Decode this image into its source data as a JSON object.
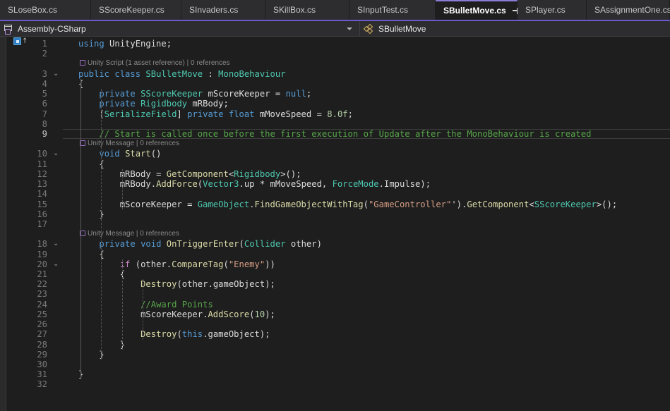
{
  "window": {
    "app": "Visual Studio",
    "theme": "dark"
  },
  "tabs": {
    "items": [
      {
        "label": "SLoseBox.cs",
        "active": false
      },
      {
        "label": "SScoreKeeper.cs",
        "active": false
      },
      {
        "label": "SInvaders.cs",
        "active": false
      },
      {
        "label": "SKillBox.cs",
        "active": false
      },
      {
        "label": "SInputTest.cs",
        "active": false
      },
      {
        "label": "SBulletMove.cs",
        "active": true
      },
      {
        "label": "SPlayer.cs",
        "active": false
      },
      {
        "label": "SAssignmentOne.cs",
        "active": false
      }
    ],
    "pin_icon": "pin-icon",
    "close_icon": "close-icon"
  },
  "navbar": {
    "project": "Assembly-CSharp",
    "project_icon": "project-icon",
    "member": "SBulletMove",
    "member_icon": "class-icon",
    "dropdown_icon": "chevron-down-icon"
  },
  "editor": {
    "filename": "SBulletMove.cs",
    "current_line": 9,
    "total_lines": 32,
    "glyph_icon": "unity-script-glyph-icon",
    "codelens": [
      {
        "line": 3,
        "text": "Unity Script (1 asset reference) | 0 references"
      },
      {
        "line": 10,
        "text": "Unity Message | 0 references"
      },
      {
        "line": 18,
        "text": "Unity Message | 0 references"
      }
    ],
    "lines": [
      {
        "n": 1,
        "tokens": [
          [
            "k",
            "using"
          ],
          [
            "id",
            " UnityEngine"
          ],
          [
            "p",
            ";"
          ]
        ]
      },
      {
        "n": 2,
        "tokens": []
      },
      {
        "n": 3,
        "tokens": [
          [
            "k",
            "public"
          ],
          [
            "id",
            " "
          ],
          [
            "k",
            "class"
          ],
          [
            "id",
            " "
          ],
          [
            "t",
            "SBulletMove"
          ],
          [
            "p",
            " : "
          ],
          [
            "t",
            "MonoBehaviour"
          ]
        ]
      },
      {
        "n": 4,
        "tokens": [
          [
            "p",
            "{"
          ]
        ]
      },
      {
        "n": 5,
        "tokens": [
          [
            "p",
            "    "
          ],
          [
            "k",
            "private"
          ],
          [
            "id",
            " "
          ],
          [
            "t",
            "SScoreKeeper"
          ],
          [
            "id",
            " mScoreKeeper "
          ],
          [
            "p",
            "= "
          ],
          [
            "k",
            "null"
          ],
          [
            "p",
            ";"
          ]
        ]
      },
      {
        "n": 6,
        "tokens": [
          [
            "p",
            "    "
          ],
          [
            "k",
            "private"
          ],
          [
            "id",
            " "
          ],
          [
            "t",
            "Rigidbody"
          ],
          [
            "id",
            " mRBody"
          ],
          [
            "p",
            ";"
          ]
        ]
      },
      {
        "n": 7,
        "tokens": [
          [
            "p",
            "    ["
          ],
          [
            "t",
            "SerializeField"
          ],
          [
            "p",
            "] "
          ],
          [
            "k",
            "private"
          ],
          [
            "id",
            " "
          ],
          [
            "k",
            "float"
          ],
          [
            "id",
            " mMoveSpeed "
          ],
          [
            "p",
            "= "
          ],
          [
            "n",
            "8.0f"
          ],
          [
            "p",
            ";"
          ]
        ]
      },
      {
        "n": 8,
        "tokens": []
      },
      {
        "n": 9,
        "tokens": [
          [
            "p",
            "    "
          ],
          [
            "c",
            "// Start is called once before the first execution of Update after the MonoBehaviour is created"
          ]
        ]
      },
      {
        "n": 10,
        "tokens": [
          [
            "p",
            "    "
          ],
          [
            "k",
            "void"
          ],
          [
            "id",
            " "
          ],
          [
            "m",
            "Start"
          ],
          [
            "p",
            "()"
          ]
        ]
      },
      {
        "n": 11,
        "tokens": [
          [
            "p",
            "    {"
          ]
        ]
      },
      {
        "n": 12,
        "tokens": [
          [
            "p",
            "        "
          ],
          [
            "id",
            "mRBody "
          ],
          [
            "p",
            "= "
          ],
          [
            "m",
            "GetComponent"
          ],
          [
            "p",
            "<"
          ],
          [
            "t",
            "Rigidbody"
          ],
          [
            "p",
            ">();"
          ]
        ]
      },
      {
        "n": 13,
        "tokens": [
          [
            "p",
            "        "
          ],
          [
            "id",
            "mRBody"
          ],
          [
            "p",
            "."
          ],
          [
            "m",
            "AddForce"
          ],
          [
            "p",
            "("
          ],
          [
            "t",
            "Vector3"
          ],
          [
            "p",
            "."
          ],
          [
            "id",
            "up"
          ],
          [
            "p",
            " * "
          ],
          [
            "id",
            "mMoveSpeed"
          ],
          [
            "p",
            ", "
          ],
          [
            "t",
            "ForceMode"
          ],
          [
            "p",
            "."
          ],
          [
            "id",
            "Impulse"
          ],
          [
            "p",
            ");"
          ]
        ]
      },
      {
        "n": 14,
        "tokens": []
      },
      {
        "n": 15,
        "tokens": [
          [
            "p",
            "        "
          ],
          [
            "id",
            "mScoreKeeper "
          ],
          [
            "p",
            "= "
          ],
          [
            "t",
            "GameObject"
          ],
          [
            "p",
            "."
          ],
          [
            "m",
            "FindGameObjectWithTag"
          ],
          [
            "p",
            "("
          ],
          [
            "s",
            "\"GameController\""
          ],
          [
            "p",
            "')."
          ],
          [
            "m",
            "GetComponent"
          ],
          [
            "p",
            "<"
          ],
          [
            "t",
            "SScoreKeeper"
          ],
          [
            "p",
            ">();"
          ]
        ]
      },
      {
        "n": 16,
        "tokens": [
          [
            "p",
            "    }"
          ]
        ]
      },
      {
        "n": 17,
        "tokens": []
      },
      {
        "n": 18,
        "tokens": [
          [
            "p",
            "    "
          ],
          [
            "k",
            "private"
          ],
          [
            "id",
            " "
          ],
          [
            "k",
            "void"
          ],
          [
            "id",
            " "
          ],
          [
            "m",
            "OnTriggerEnter"
          ],
          [
            "p",
            "("
          ],
          [
            "t",
            "Collider"
          ],
          [
            "id",
            " other"
          ],
          [
            "p",
            ")"
          ]
        ]
      },
      {
        "n": 19,
        "tokens": [
          [
            "p",
            "    {"
          ]
        ]
      },
      {
        "n": 20,
        "tokens": [
          [
            "p",
            "        "
          ],
          [
            "kc",
            "if"
          ],
          [
            "p",
            " ("
          ],
          [
            "id",
            "other"
          ],
          [
            "p",
            "."
          ],
          [
            "m",
            "CompareTag"
          ],
          [
            "p",
            "("
          ],
          [
            "s",
            "\"Enemy\""
          ],
          [
            "p",
            "))"
          ]
        ]
      },
      {
        "n": 21,
        "tokens": [
          [
            "p",
            "        {"
          ]
        ]
      },
      {
        "n": 22,
        "tokens": [
          [
            "p",
            "            "
          ],
          [
            "m",
            "Destroy"
          ],
          [
            "p",
            "("
          ],
          [
            "id",
            "other"
          ],
          [
            "p",
            "."
          ],
          [
            "id",
            "gameObject"
          ],
          [
            "p",
            ");"
          ]
        ]
      },
      {
        "n": 23,
        "tokens": []
      },
      {
        "n": 24,
        "tokens": [
          [
            "p",
            "            "
          ],
          [
            "c",
            "//Award Points"
          ]
        ]
      },
      {
        "n": 25,
        "tokens": [
          [
            "p",
            "            "
          ],
          [
            "id",
            "mScoreKeeper"
          ],
          [
            "p",
            "."
          ],
          [
            "m",
            "AddScore"
          ],
          [
            "p",
            "("
          ],
          [
            "n",
            "10"
          ],
          [
            "p",
            ");"
          ]
        ]
      },
      {
        "n": 26,
        "tokens": []
      },
      {
        "n": 27,
        "tokens": [
          [
            "p",
            "            "
          ],
          [
            "m",
            "Destroy"
          ],
          [
            "p",
            "("
          ],
          [
            "k",
            "this"
          ],
          [
            "p",
            "."
          ],
          [
            "id",
            "gameObject"
          ],
          [
            "p",
            ");"
          ]
        ]
      },
      {
        "n": 28,
        "tokens": [
          [
            "p",
            "        }"
          ]
        ]
      },
      {
        "n": 29,
        "tokens": [
          [
            "p",
            "    }"
          ]
        ]
      },
      {
        "n": 30,
        "tokens": []
      },
      {
        "n": 31,
        "tokens": [
          [
            "p",
            "}"
          ]
        ]
      },
      {
        "n": 32,
        "tokens": []
      }
    ],
    "fold_markers": [
      3,
      10,
      18,
      20
    ]
  },
  "colors": {
    "accent": "#6a5acd",
    "editor_bg": "#1e1e1e",
    "chrome_bg": "#2d2d30",
    "keyword": "#569cd6",
    "type": "#4ec9b0",
    "string": "#d69d85",
    "comment": "#57a64a",
    "method": "#dcdcaa",
    "number": "#b5cea8"
  }
}
